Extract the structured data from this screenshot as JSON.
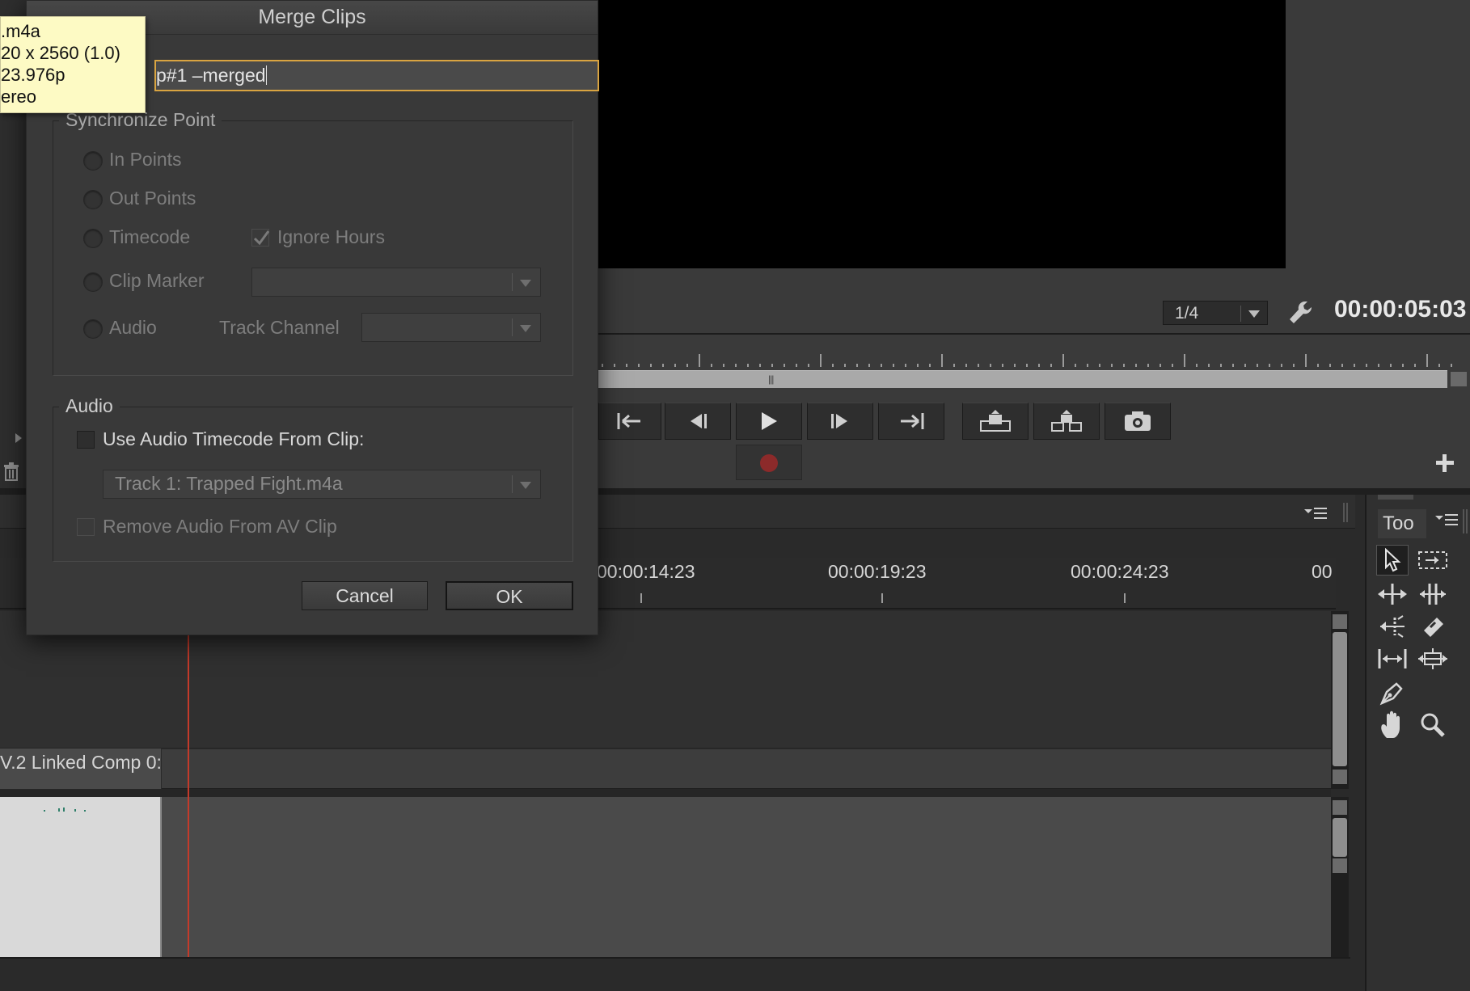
{
  "tooltip": {
    "lines": [
      ".m4a",
      "20 x 2560 (1.0)",
      "23.976p",
      "ereo"
    ]
  },
  "dialog": {
    "title": "Merge Clips",
    "name_value": "p#1 –merged",
    "sync_group": {
      "legend": "Synchronize Point",
      "options": {
        "in_points": "In Points",
        "out_points": "Out Points",
        "timecode": "Timecode",
        "clip_marker": "Clip Marker",
        "audio": "Audio"
      },
      "ignore_hours": "Ignore Hours",
      "track_channel": "Track Channel",
      "clip_marker_value": "",
      "track_channel_value": ""
    },
    "audio_group": {
      "legend": "Audio",
      "use_audio_timecode": "Use Audio Timecode From Clip:",
      "track_value": "Track 1: Trapped Fight.m4a",
      "remove_audio": "Remove Audio From AV Clip"
    },
    "cancel_label": "Cancel",
    "ok_label": "OK",
    "accent_color": "#d9a441"
  },
  "monitor": {
    "zoom": "1/4",
    "timecode": "00:00:05:03",
    "playhead_color": "#c43a2a"
  },
  "sequence": {
    "time_labels": [
      "00:00:14:23",
      "00:00:19:23",
      "00:00:24:23",
      "00"
    ],
    "clip_label": "V.2 Linked Comp 0:"
  },
  "tools": {
    "tab_label": "Too",
    "items": [
      "selection-tool",
      "track-select-tool",
      "ripple-edit-tool",
      "rolling-edit-tool",
      "rate-stretch-tool",
      "razor-tool",
      "slip-tool",
      "slide-tool",
      "pen-tool",
      "hand-tool",
      "zoom-tool"
    ]
  }
}
